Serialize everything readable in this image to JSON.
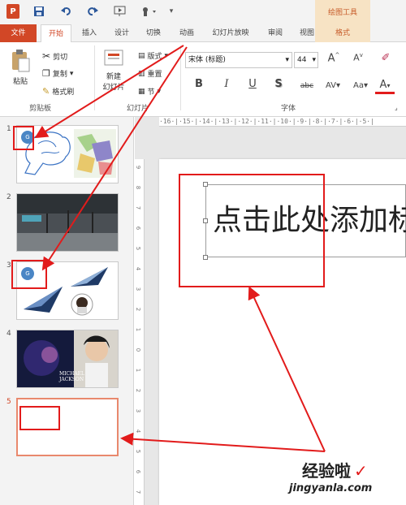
{
  "app": {
    "logo": "P"
  },
  "tabs": [
    "文件",
    "开始",
    "插入",
    "设计",
    "切换",
    "动画",
    "幻灯片放映",
    "审阅",
    "视图",
    "格式"
  ],
  "context_tab_group": "绘图工具",
  "ribbon": {
    "clipboard": {
      "paste": "粘贴",
      "cut": "剪切",
      "copy": "复制",
      "format_painter": "格式刷",
      "label": "剪贴板"
    },
    "slides": {
      "new_slide": "新建\n幻灯片",
      "layout": "版式",
      "reset": "重置",
      "section": "节",
      "label": "幻灯片"
    },
    "font": {
      "font_name": "宋体 (标题)",
      "font_size": "44",
      "label": "字体",
      "bold": "B",
      "italic": "I",
      "underline": "U",
      "shadow": "S",
      "strikethrough": "abc",
      "spacing": "AV",
      "case": "Aa",
      "color": "A",
      "grow": "A",
      "shrink": "A"
    }
  },
  "ruler": {
    "h": "·16·|·15·|·14·|·13·|·12·|·11·|·10·|·9·|·8·|·7·|·6·|·5·|",
    "v": [
      "9",
      "8",
      "7",
      "6",
      "5",
      "4",
      "3",
      "2",
      "1",
      "0",
      "1",
      "2",
      "3",
      "4",
      "5",
      "6",
      "7"
    ]
  },
  "thumbnails": [
    {
      "number": "1"
    },
    {
      "number": "2"
    },
    {
      "number": "3"
    },
    {
      "number": "4"
    },
    {
      "number": "5"
    }
  ],
  "thumb1_badge": "G",
  "thumb3_badge": "G",
  "thumb4_caption": "MICHAEL\nJACKSON",
  "slide": {
    "title_placeholder": "点击此处添加标"
  },
  "watermark": {
    "brand": "经验啦",
    "url": "jingyanla.com"
  },
  "colors": {
    "accent": "#d24726",
    "annotation": "#e21b1b"
  }
}
